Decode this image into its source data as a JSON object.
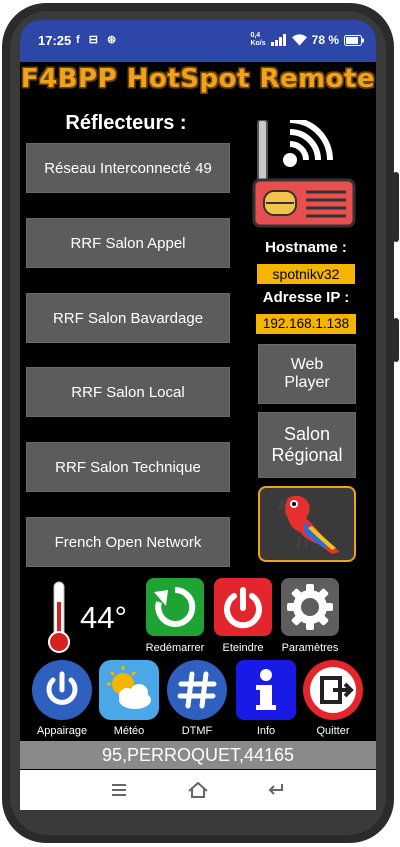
{
  "statusbar": {
    "time": "17:25",
    "notifications": "f ⊟ ⊛",
    "net_speed": "0,4\nKo/s",
    "battery": "78 %"
  },
  "app_title": "F4BPP HotSpot Remote",
  "reflectors": {
    "title": "Réflecteurs :",
    "items": [
      "Réseau Interconnecté 49",
      "RRF Salon Appel",
      "RRF Salon Bavardage",
      "RRF Salon Local",
      "RRF Salon Technique",
      "French Open Network"
    ]
  },
  "info": {
    "hostname_label": "Hostname :",
    "hostname_value": "spotnikv32",
    "ip_label": "Adresse IP :",
    "ip_value": "192.168.1.138"
  },
  "buttons": {
    "web_player_line1": "Web",
    "web_player_line2": "Player",
    "salon_regional_line1": "Salon",
    "salon_regional_line2": "Régional"
  },
  "temperature": "44°",
  "actions": {
    "restart": "Redémarrer",
    "shutdown": "Eteindre",
    "settings": "Paramètres",
    "pairing": "Appairage",
    "weather": "Météo",
    "dtmf": "DTMF",
    "info": "Info",
    "quit": "Quitter"
  },
  "footer_text": "95,PERROQUET,44165",
  "colors": {
    "statusbar": "#2e46a8",
    "accent": "#f0a21c",
    "value_bg": "#f5b400",
    "button_gray": "#5c5c5c",
    "restart_green": "#1fa335",
    "shutdown_red": "#e3262b",
    "blue_round": "#2f5fbf",
    "info_blue": "#1a1ae6"
  },
  "icons": [
    "wifi-icon",
    "signal-icon",
    "battery-icon",
    "radio-icon",
    "parrot-icon",
    "thermometer-icon",
    "restart-icon",
    "power-icon",
    "gear-icon",
    "bluetooth-power-icon",
    "weather-icon",
    "hash-icon",
    "info-icon",
    "exit-icon",
    "menu-icon",
    "home-icon",
    "back-icon"
  ]
}
